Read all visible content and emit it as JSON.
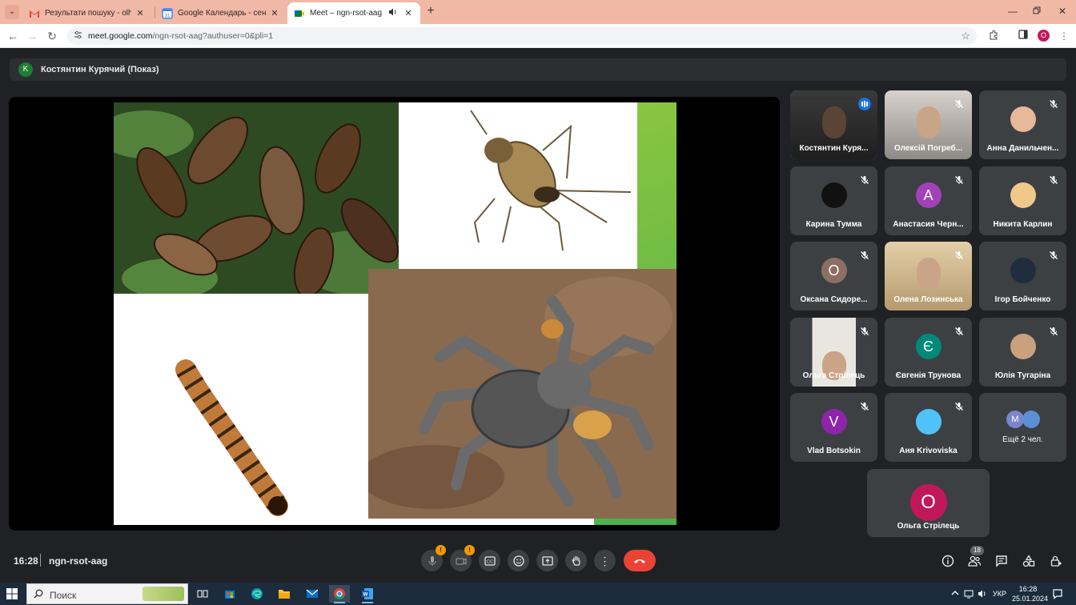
{
  "browser": {
    "tabs": [
      {
        "title": "Результати пошуку - olhastrile",
        "favicon": "gmail-icon"
      },
      {
        "title": "Google Календарь - сентябрь",
        "favicon": "calendar-icon"
      },
      {
        "title": "Meet – ngn-rsot-aag",
        "favicon": "meet-icon",
        "active": true,
        "audio": true
      }
    ],
    "url_host": "meet.google.com",
    "url_path": "/ngn-rsot-aag?authuser=0&pli=1",
    "profile_initial": "O"
  },
  "meet": {
    "presenter": {
      "initial": "K",
      "label": "Костянтин Курячий (Показ)"
    },
    "participants": [
      {
        "name": "Костянтин Куря...",
        "kind": "video",
        "active": true,
        "speaking": true
      },
      {
        "name": "Олексій Погреб...",
        "kind": "video"
      },
      {
        "name": "Анна Данильчен...",
        "kind": "photo",
        "photo_color": "#e8b89a"
      },
      {
        "name": "Карина Тумма",
        "kind": "photo",
        "photo_color": "#111111"
      },
      {
        "name": "Анастасия Черн...",
        "kind": "letter",
        "letter": "A",
        "color": "#a142b8"
      },
      {
        "name": "Никита Карлин",
        "kind": "photo",
        "photo_color": "#f0c98a"
      },
      {
        "name": "Оксана Сидоре...",
        "kind": "letter",
        "letter": "О",
        "color": "#8d6e63"
      },
      {
        "name": "Олена Лозинська",
        "kind": "video"
      },
      {
        "name": "Ігор Бойченко",
        "kind": "photo",
        "photo_color": "#1f2d3d"
      },
      {
        "name": "Ольга Стрілець",
        "kind": "video"
      },
      {
        "name": "Євгенія Трунова",
        "kind": "letter",
        "letter": "Є",
        "color": "#00897b"
      },
      {
        "name": "Юлія Тугаріна",
        "kind": "photo",
        "photo_color": "#c9a27d"
      },
      {
        "name": "Vlad Botsokin",
        "kind": "letter",
        "letter": "V",
        "color": "#8e24aa"
      },
      {
        "name": "Аня Krivoviska",
        "kind": "photo",
        "photo_color": "#4fc3f7"
      },
      {
        "name": "Ещё 2 чел.",
        "kind": "more",
        "letter": "M"
      }
    ],
    "self_tile": {
      "name": "Ольга Стрілець",
      "letter": "О",
      "color": "#c2185b"
    },
    "time": "16:28",
    "code": "ngn-rsot-aag",
    "mic_badge": "!",
    "cam_badge": "!",
    "participant_count": "18"
  },
  "taskbar": {
    "search_placeholder": "Поиск",
    "language": "УКР",
    "clock_time": "16:28",
    "clock_date": "25.01.2024"
  },
  "colors": {
    "meet_bg": "#202124",
    "tab_strip": "#f2b8a6",
    "hangup": "#ea4335",
    "active_outline": "#8ab4f8"
  }
}
